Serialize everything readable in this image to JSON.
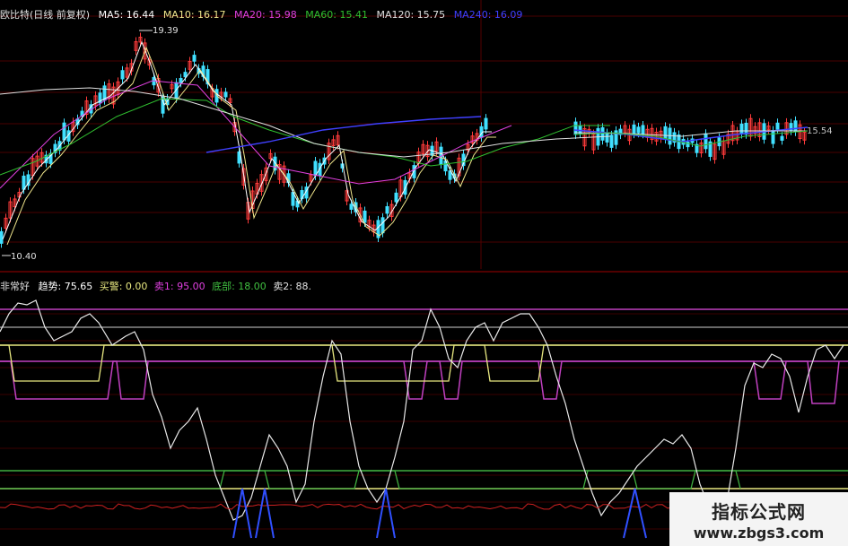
{
  "main_header": {
    "title": "欧比特(日线 前复权)",
    "ma5": "MA5: 16.44",
    "ma10": "MA10: 16.17",
    "ma20": "MA20: 15.98",
    "ma60": "MA60: 15.41",
    "ma120": "MA120: 15.75",
    "ma240": "MA240: 16.09"
  },
  "price_labels": {
    "high": "19.39",
    "low": "10.40",
    "last": "15.54"
  },
  "indicator_header": {
    "name": "非常好",
    "trend": "趋势: 75.65",
    "alert": "买警: 0.00",
    "sell1": "卖1: 95.00",
    "bottom": "底部: 18.00",
    "sell2": "卖2: 88."
  },
  "watermark": {
    "line1": "指标公式网",
    "line2": "www.zbgs3.com"
  },
  "colors": {
    "ma5": "#ffffff",
    "ma10": "#f0e68c",
    "ma20": "#e040e0",
    "ma60": "#30c030",
    "ma120": "#e0e0e0",
    "ma240": "#4040ff",
    "up_candle": "#ff3b3b",
    "down_candle": "#40e0ff",
    "level_magenta": "#c040c0",
    "level_yellow": "#e8e880",
    "level_green": "#40b040",
    "baseline": "#d02020"
  }
}
